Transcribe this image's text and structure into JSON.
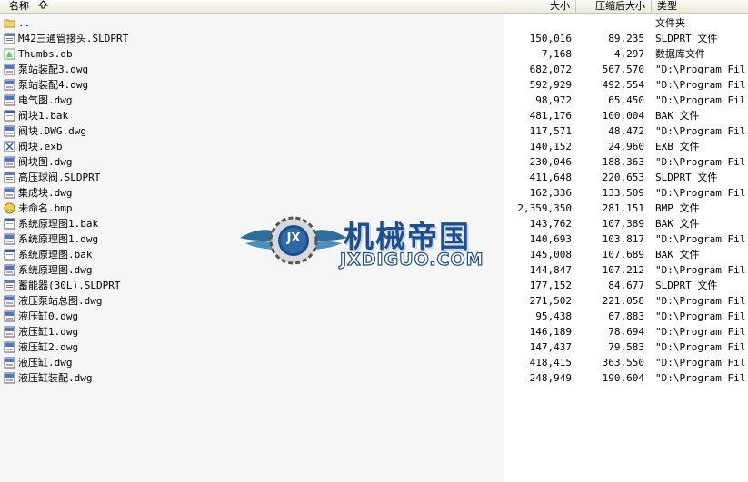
{
  "columns": {
    "name": "名称",
    "size": "大小",
    "compressed": "压缩后大小",
    "type": "类型"
  },
  "watermark": {
    "title": "机械帝国",
    "subtitle": "JXDIGUO.COM",
    "emblem": "JX"
  },
  "files": [
    {
      "icon": "folder-up-icon",
      "name": "..",
      "size": "",
      "compressed": "",
      "type": "文件夹"
    },
    {
      "icon": "sldprt-file-icon",
      "name": "M42三通管接头.SLDPRT",
      "size": "150,016",
      "compressed": "89,235",
      "type": "SLDPRT 文件"
    },
    {
      "icon": "db-file-icon",
      "name": "Thumbs.db",
      "size": "7,168",
      "compressed": "4,297",
      "type": "数据库文件"
    },
    {
      "icon": "dwg-file-icon",
      "name": "泵站装配3.dwg",
      "size": "682,072",
      "compressed": "567,570",
      "type": "\"D:\\Program Fil..."
    },
    {
      "icon": "dwg-file-icon",
      "name": "泵站装配4.dwg",
      "size": "592,929",
      "compressed": "492,554",
      "type": "\"D:\\Program Fil..."
    },
    {
      "icon": "dwg-file-icon",
      "name": "电气图.dwg",
      "size": "98,972",
      "compressed": "65,450",
      "type": "\"D:\\Program Fil..."
    },
    {
      "icon": "generic-file-icon",
      "name": "阀块1.bak",
      "size": "481,176",
      "compressed": "100,004",
      "type": "BAK 文件"
    },
    {
      "icon": "dwg-file-icon",
      "name": "阀块.DWG.dwg",
      "size": "117,571",
      "compressed": "48,472",
      "type": "\"D:\\Program Fil..."
    },
    {
      "icon": "exb-file-icon",
      "name": "阀块.exb",
      "size": "140,152",
      "compressed": "24,960",
      "type": "EXB 文件"
    },
    {
      "icon": "dwg-file-icon",
      "name": "阀块图.dwg",
      "size": "230,046",
      "compressed": "188,363",
      "type": "\"D:\\Program Fil..."
    },
    {
      "icon": "sldprt-file-icon",
      "name": "高压球阀.SLDPRT",
      "size": "411,648",
      "compressed": "220,653",
      "type": "SLDPRT 文件"
    },
    {
      "icon": "dwg-file-icon",
      "name": "集成块.dwg",
      "size": "162,336",
      "compressed": "133,509",
      "type": "\"D:\\Program Fil..."
    },
    {
      "icon": "bmp-file-icon",
      "name": "未命名.bmp",
      "size": "2,359,350",
      "compressed": "281,151",
      "type": "BMP 文件"
    },
    {
      "icon": "generic-file-icon",
      "name": "系统原理图1.bak",
      "size": "143,762",
      "compressed": "107,389",
      "type": "BAK 文件"
    },
    {
      "icon": "dwg-file-icon",
      "name": "系统原理图1.dwg",
      "size": "140,693",
      "compressed": "103,817",
      "type": "\"D:\\Program Fil..."
    },
    {
      "icon": "generic-file-icon",
      "name": "系统原理图.bak",
      "size": "145,008",
      "compressed": "107,689",
      "type": "BAK 文件"
    },
    {
      "icon": "dwg-file-icon",
      "name": "系统原理图.dwg",
      "size": "144,847",
      "compressed": "107,212",
      "type": "\"D:\\Program Fil..."
    },
    {
      "icon": "sldprt-file-icon",
      "name": "蓄能器(30L).SLDPRT",
      "size": "177,152",
      "compressed": "84,677",
      "type": "SLDPRT 文件"
    },
    {
      "icon": "dwg-file-icon",
      "name": "液压泵站总图.dwg",
      "size": "271,502",
      "compressed": "221,058",
      "type": "\"D:\\Program Fil..."
    },
    {
      "icon": "dwg-file-icon",
      "name": "液压缸0.dwg",
      "size": "95,438",
      "compressed": "67,883",
      "type": "\"D:\\Program Fil..."
    },
    {
      "icon": "dwg-file-icon",
      "name": "液压缸1.dwg",
      "size": "146,189",
      "compressed": "78,694",
      "type": "\"D:\\Program Fil..."
    },
    {
      "icon": "dwg-file-icon",
      "name": "液压缸2.dwg",
      "size": "147,437",
      "compressed": "79,583",
      "type": "\"D:\\Program Fil..."
    },
    {
      "icon": "dwg-file-icon",
      "name": "液压缸.dwg",
      "size": "418,415",
      "compressed": "363,550",
      "type": "\"D:\\Program Fil..."
    },
    {
      "icon": "dwg-file-icon",
      "name": "液压缸装配.dwg",
      "size": "248,949",
      "compressed": "190,604",
      "type": "\"D:\\Program Fil..."
    }
  ]
}
